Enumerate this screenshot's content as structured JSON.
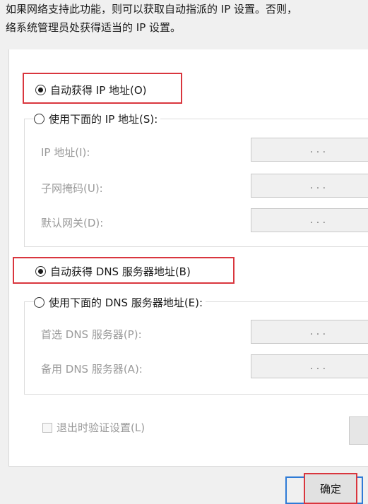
{
  "description": {
    "line1": "如果网络支持此功能，则可以获取自动指派的 IP 设置。否则，",
    "line2": "络系统管理员处获得适当的 IP 设置。"
  },
  "ip_section": {
    "auto_label": "自动获得 IP 地址(O)",
    "auto_checked": true,
    "manual_label": "使用下面的 IP 地址(S):",
    "manual_checked": false,
    "fields": [
      {
        "label": "IP 地址(I):",
        "dots": ".   .   ."
      },
      {
        "label": "子网掩码(U):",
        "dots": ".   .   ."
      },
      {
        "label": "默认网关(D):",
        "dots": ".   .   ."
      }
    ]
  },
  "dns_section": {
    "auto_label": "自动获得 DNS 服务器地址(B)",
    "auto_checked": true,
    "manual_label": "使用下面的 DNS 服务器地址(E):",
    "manual_checked": false,
    "fields": [
      {
        "label": "首选 DNS 服务器(P):",
        "dots": ".   .   ."
      },
      {
        "label": "备用 DNS 服务器(A):",
        "dots": ".   .   ."
      }
    ]
  },
  "validate_on_exit": {
    "label": "退出时验证设置(L)",
    "checked": false
  },
  "footer": {
    "ok_label": "确定"
  },
  "colors": {
    "highlight_red": "#d9363e",
    "button_blue": "#2f7bd6"
  }
}
